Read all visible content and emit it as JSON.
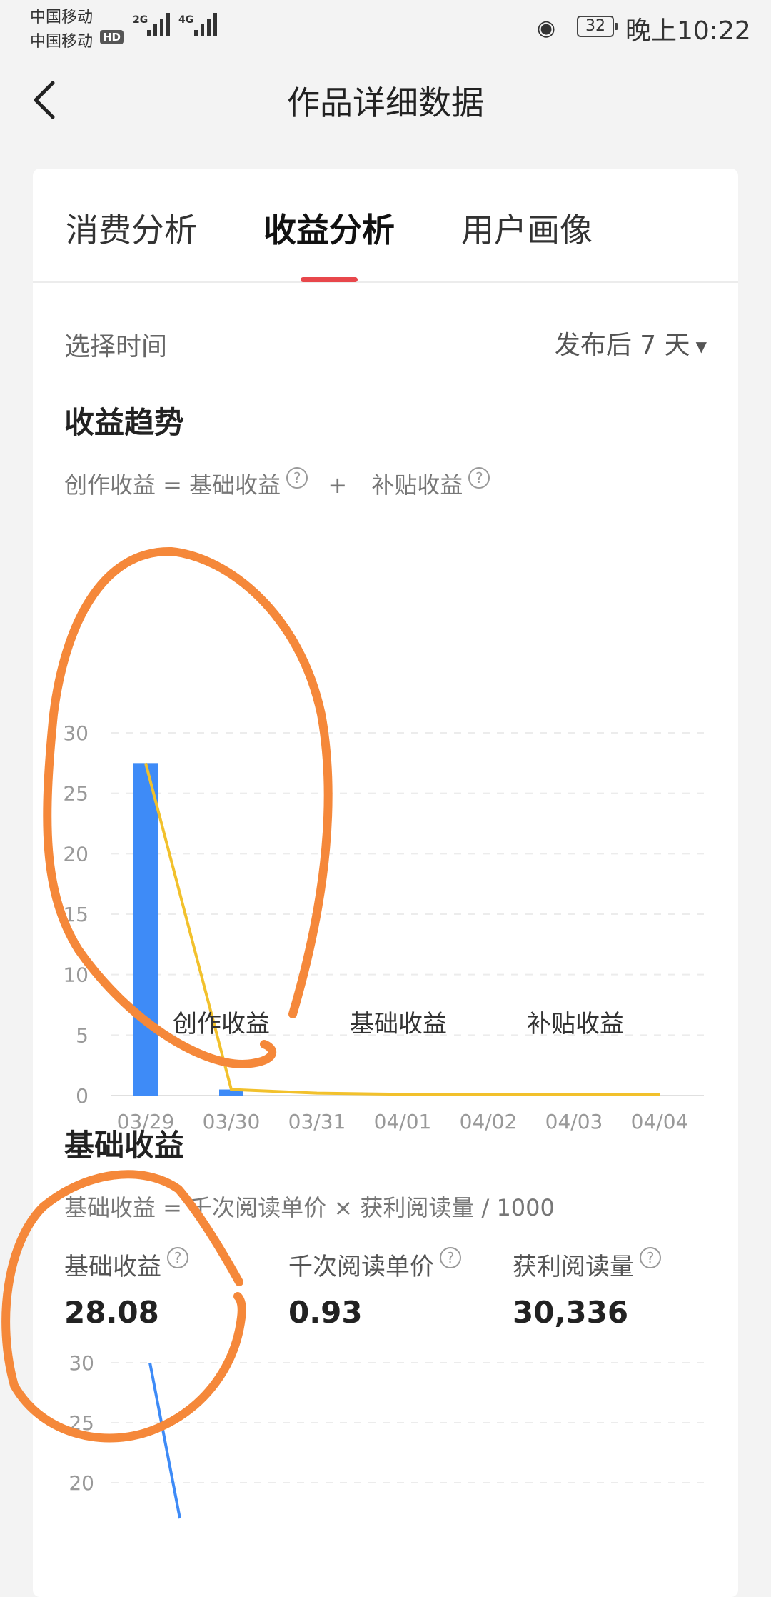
{
  "status_bar": {
    "carrier1": "中国移动",
    "carrier2": "中国移动",
    "hd": "HD",
    "net1": "2G",
    "net2": "4G",
    "battery": "32",
    "time": "晚上10:22"
  },
  "nav": {
    "title": "作品详细数据"
  },
  "tabs": [
    {
      "label": "消费分析"
    },
    {
      "label": "收益分析"
    },
    {
      "label": "用户画像"
    }
  ],
  "active_tab": 1,
  "time_filter": {
    "label": "选择时间",
    "value": "发布后 7 天"
  },
  "trend": {
    "title": "收益趋势",
    "formula_left": "创作收益 = 基础收益",
    "formula_plus": "+",
    "formula_right": "补贴收益",
    "legend": [
      "创作收益",
      "基础收益",
      "补贴收益"
    ]
  },
  "base": {
    "title": "基础收益",
    "formula": "基础收益 = 千次阅读单价 × 获利阅读量 / 1000",
    "stats": [
      {
        "label": "基础收益",
        "value": "28.08"
      },
      {
        "label": "千次阅读单价",
        "value": "0.93"
      },
      {
        "label": "获利阅读量",
        "value": "30,336"
      }
    ]
  },
  "colors": {
    "bar": "#3e8bf7",
    "line": "#f2c12c",
    "accent": "#e8474b",
    "annotation": "#f5883a"
  },
  "chart_data": [
    {
      "type": "bar",
      "categories": [
        "03/29",
        "03/30",
        "03/31",
        "04/01",
        "04/02",
        "04/03",
        "04/04"
      ],
      "ylim": [
        0,
        30
      ],
      "yticks": [
        0,
        5,
        10,
        15,
        20,
        25,
        30
      ],
      "grid": true,
      "series": [
        {
          "name": "创作收益",
          "kind": "bar",
          "values": [
            27.5,
            0.5,
            0,
            0,
            0,
            0,
            0
          ]
        },
        {
          "name": "补贴收益",
          "kind": "line",
          "values": [
            27.5,
            0.5,
            0.2,
            0.1,
            0.1,
            0.1,
            0.1
          ]
        }
      ]
    },
    {
      "type": "line",
      "ylim": [
        20,
        30
      ],
      "yticks": [
        20,
        25,
        30
      ],
      "grid": true,
      "series": [
        {
          "values": [
            30,
            20
          ]
        }
      ]
    }
  ]
}
